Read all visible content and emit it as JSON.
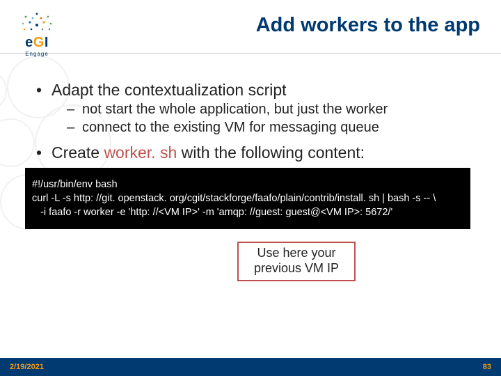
{
  "header": {
    "logo_main_blue": "e",
    "logo_main_orange": "G",
    "logo_main_blue2": "I",
    "logo_sub": "Engage",
    "title": "Add workers to the app"
  },
  "bullets": {
    "b1": "Adapt the contextualization script",
    "b1_sub1": "not start the whole application, but just the worker",
    "b1_sub2": "connect to the existing VM for messaging queue",
    "b2_pre": "Create ",
    "b2_accent": "worker. sh",
    "b2_post": " with the following content:"
  },
  "code": {
    "line1": "#!/usr/bin/env bash",
    "line2": "curl -L -s http: //git. openstack. org/cgit/stackforge/faafo/plain/contrib/install. sh | bash -s -- \\",
    "line3": "   -i faafo -r worker -e 'http: //<VM IP>' -m 'amqp: //guest: guest@<VM IP>: 5672/'"
  },
  "callout": {
    "line1": "Use here your",
    "line2": "previous VM IP"
  },
  "footer": {
    "date": "2/19/2021",
    "page": "83"
  }
}
